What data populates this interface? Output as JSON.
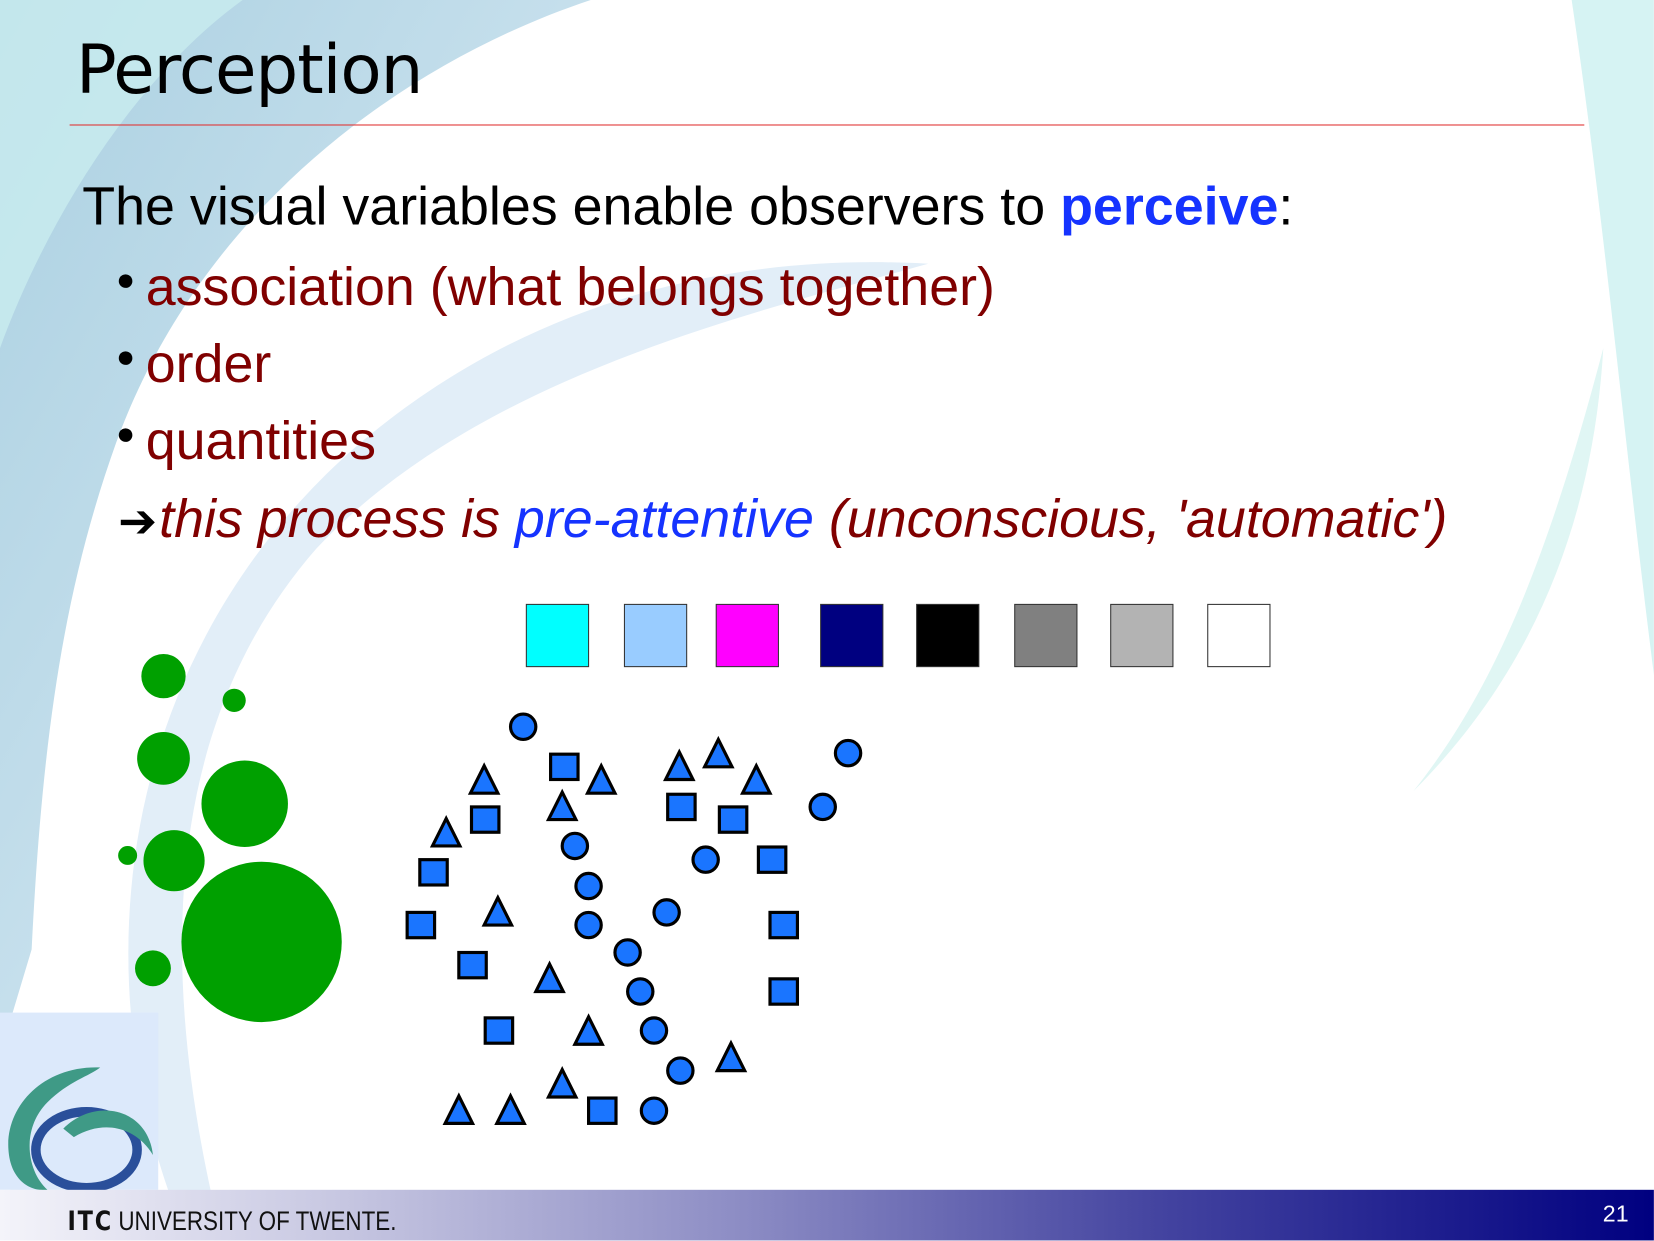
{
  "slide": {
    "title": "Perception",
    "intro_prefix": "The visual variables enable observers to ",
    "intro_emphasis": "perceive",
    "intro_suffix": ":",
    "bullets": [
      "association (what belongs together)",
      "order",
      "quantities"
    ],
    "conclusion_prefix": "this process is ",
    "conclusion_emphasis": "pre-attentive",
    "conclusion_suffix": " (unconscious, 'automatic')",
    "page_number": "21"
  },
  "colors": {
    "accent_blue": "#1533ff",
    "bullet_text": "#800000",
    "rule": "#e03030",
    "symbol_fill": "#1a75ff",
    "proportional_circle_fill": "#00a000",
    "footer_end": "#000080"
  },
  "color_swatches": [
    "#00ffff",
    "#99ccff",
    "#ff00ff",
    "#000080",
    "#000000",
    "#808080",
    "#b3b3b3",
    "#ffffff"
  ],
  "footer": {
    "logo_text": "ITC",
    "institution": "UNIVERSITY OF TWENTE."
  },
  "icons": {
    "bullet": "bullet-dot-icon",
    "arrow": "right-arrow-icon",
    "logo": "itc-swirl-logo-icon"
  }
}
